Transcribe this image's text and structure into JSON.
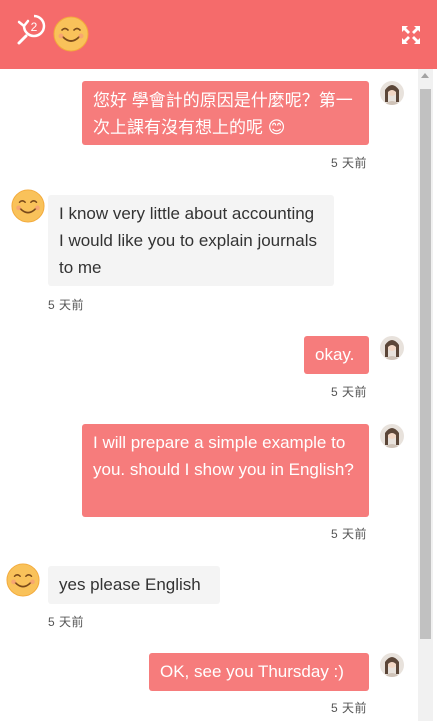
{
  "header": {
    "back_badge": "2",
    "back_icon": "back-arrow-icon",
    "expand_icon": "expand-icon",
    "color": "#f56b6b"
  },
  "colors": {
    "outgoing": "#f67c7c",
    "incoming": "#f4f4f4"
  },
  "messages": [
    {
      "direction": "out",
      "text": "您好 學會計的原因是什麼呢？第一次上課有沒有想上的呢 😊",
      "time": "5 天前"
    },
    {
      "direction": "in",
      "text": "I know very little about accounting I would like you to explain journals to me",
      "time": "5 天前"
    },
    {
      "direction": "out",
      "text": "okay.",
      "time": "5 天前"
    },
    {
      "direction": "out",
      "text": "I will prepare a simple example to you. should I show you in English?",
      "time": "5 天前"
    },
    {
      "direction": "in",
      "text": "yes please English",
      "time": "5 天前"
    },
    {
      "direction": "out",
      "text": "OK, see you Thursday :)",
      "time": "5 天前"
    }
  ]
}
